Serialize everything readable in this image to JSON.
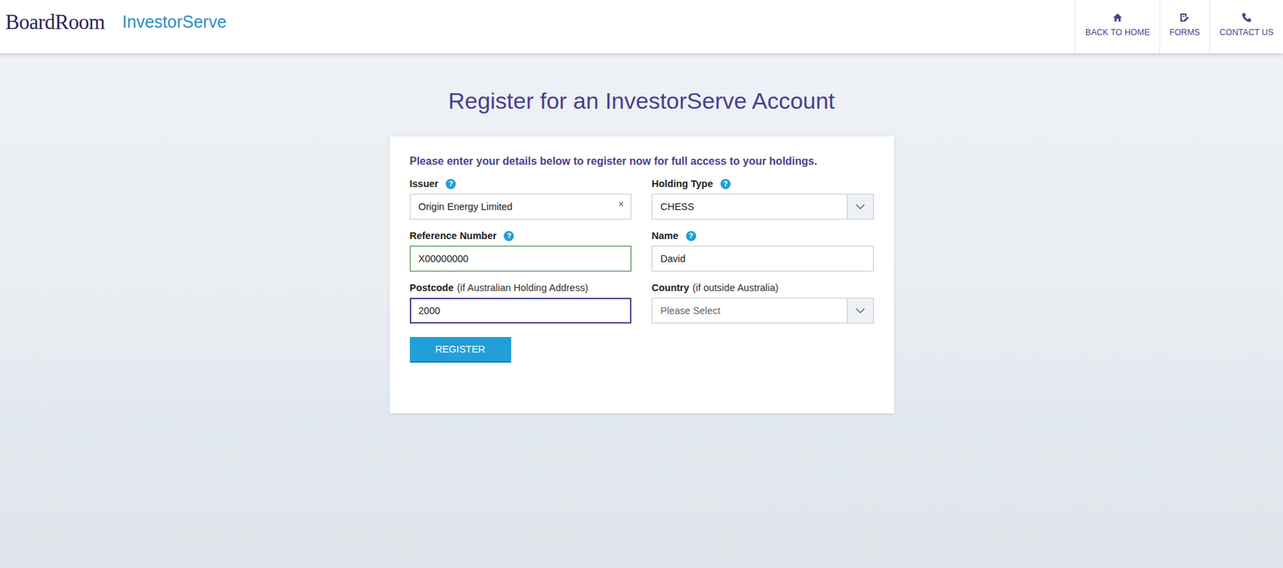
{
  "header": {
    "logo": "BoardRoom",
    "product": "InvestorServe",
    "nav": [
      {
        "label": "BACK TO HOME"
      },
      {
        "label": "FORMS"
      },
      {
        "label": "CONTACT US"
      }
    ]
  },
  "page": {
    "title": "Register for an InvestorServe Account"
  },
  "form": {
    "intro": "Please enter your details below to register now for full access to your holdings.",
    "fields": [
      {
        "label": "Issuer",
        "help": "?",
        "kind": "clearable",
        "value": "Origin Energy Limited",
        "clear": "×",
        "focused": false,
        "valid": false
      },
      {
        "label": "Holding Type",
        "help": "?",
        "kind": "select",
        "value": "CHESS",
        "focused": false,
        "valid": false
      },
      {
        "label": "Reference Number",
        "help": "?",
        "kind": "text",
        "value": "X00000000",
        "focused": false,
        "valid": true
      },
      {
        "label": "Name",
        "help": "?",
        "kind": "text",
        "value": "David",
        "focused": false,
        "valid": false
      },
      {
        "label": "Postcode",
        "hint": "(if Australian Holding Address)",
        "kind": "text",
        "value": "2000",
        "focused": true,
        "valid": false
      },
      {
        "label": "Country",
        "hint": "(if outside Australia)",
        "kind": "select",
        "placeholder": "Please Select",
        "focused": false,
        "valid": false
      }
    ],
    "submit": "REGISTER"
  }
}
